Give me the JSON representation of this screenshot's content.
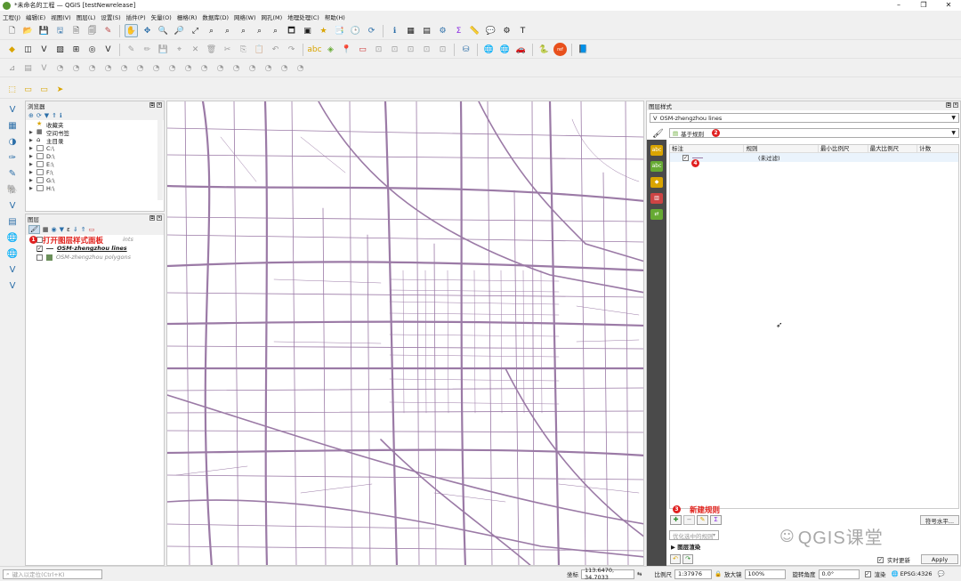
{
  "window": {
    "title": "*未命名的工程 — QGIS [testNewrelease]"
  },
  "menu": [
    "工程(J)",
    "编辑(E)",
    "视图(V)",
    "图层(L)",
    "设置(S)",
    "插件(P)",
    "矢量(O)",
    "栅格(R)",
    "数据库(D)",
    "网络(W)",
    "网孔(M)",
    "地理处理(C)",
    "帮助(H)"
  ],
  "browser": {
    "title": "浏览器",
    "items": [
      {
        "label": "收藏夹",
        "icon": "star-icon"
      },
      {
        "label": "空间书签",
        "icon": "bookmark-icon"
      },
      {
        "label": "主目录",
        "icon": "home-icon"
      },
      {
        "label": "C:\\",
        "icon": "folder-icon"
      },
      {
        "label": "D:\\",
        "icon": "folder-icon"
      },
      {
        "label": "E:\\",
        "icon": "folder-icon"
      },
      {
        "label": "F:\\",
        "icon": "folder-icon"
      },
      {
        "label": "G:\\",
        "icon": "folder-icon"
      },
      {
        "label": "H:\\",
        "icon": "folder-icon"
      }
    ]
  },
  "layers": {
    "title": "图层",
    "items": [
      {
        "label": "ints",
        "checked": false
      },
      {
        "label": "OSM-zhengzhou lines",
        "checked": true
      },
      {
        "label": "OSM-zhengzhou polygons",
        "checked": false
      }
    ]
  },
  "annotations": {
    "a1": "打开图层样式面板",
    "a3": "新建规则",
    "n1": "1",
    "n2": "2",
    "n3": "3",
    "n4": "4"
  },
  "style_panel": {
    "title": "图层样式",
    "layer": "OSM-zhengzhou lines",
    "renderer": "基于规则",
    "columns": [
      "标注",
      "规则",
      "最小比例尺",
      "最大比例尺",
      "计数"
    ],
    "rule_row": "(未过滤)",
    "refine_label": "优化选中的规则",
    "layer_render": "图层渲染",
    "symbol_level": "符号水平...",
    "live_update": "实时更新",
    "apply": "Apply"
  },
  "status": {
    "search_placeholder": "键入以定位(Ctrl+K)",
    "coord_label": "坐标",
    "coord": "113.6470, 34.7033",
    "scale_label": "比例尺",
    "scale": "1:37976",
    "mag_label": "放大镜",
    "mag": "100%",
    "rot_label": "旋转角度",
    "rot": "0.0°",
    "render_label": "渲染",
    "crs": "EPSG:4326"
  },
  "watermark": "QGIS课堂",
  "colors": {
    "road": "#9b7aa6",
    "accent": "#e02020"
  }
}
